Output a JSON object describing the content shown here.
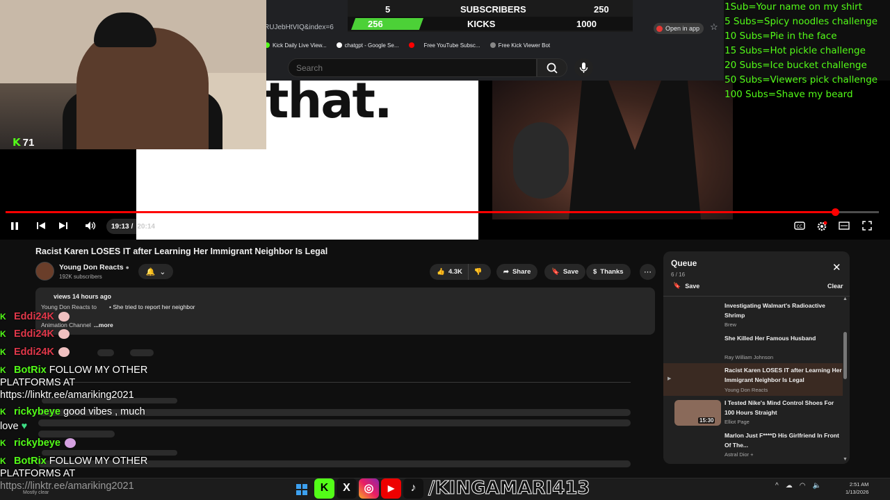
{
  "browser": {
    "url": "RUJebHtVIQ&index=6",
    "open_in_app": "Open in app",
    "bookmarks": [
      {
        "label": "Kick Daily Live View...",
        "icon": "kick-icon"
      },
      {
        "label": "chatgpt - Google Se...",
        "icon": "google-icon"
      },
      {
        "label": "",
        "icon": "youtube-icon"
      },
      {
        "label": "Free YouTube Subsc...",
        "icon": "globe-icon"
      },
      {
        "label": "Free Kick Viewer Bot",
        "icon": "globe-icon"
      }
    ]
  },
  "goal_overlay": {
    "subs_current": "5",
    "subs_label": "SUBSCRIBERS",
    "subs_goal": "250",
    "kicks_current": "256",
    "kicks_label": "KICKS",
    "kicks_goal": "1000",
    "accent": "#4cd137"
  },
  "search": {
    "placeholder": "Search"
  },
  "webcam": {
    "viewer_count": "71"
  },
  "video": {
    "overlay_text": "that.",
    "time_current": "19:13",
    "time_sep": "/",
    "time_total": "20:14",
    "progress_fraction": 0.95
  },
  "stream_goals": [
    "1Sub=Your name on my shirt",
    "5 Subs=Spicy noodles challenge",
    "10 Subs=Pie in the face",
    "15 Subs=Hot pickle challenge",
    "20 Subs=Ice bucket challenge",
    "50 Subs=Viewers pick challenge",
    "100 Subs=Shave my beard"
  ],
  "watch": {
    "title": "Racist Karen LOSES IT after Learning Her Immigrant Neighbor Is Legal",
    "channel_name": "Young Don Reacts",
    "channel_subs": "192K subscribers",
    "likes": "4.3K",
    "share": "Share",
    "save": "Save",
    "thanks": "Thanks",
    "more": "⋯",
    "desc_views": "views",
    "desc_age": "14 hours ago",
    "desc_line1_a": "Young Don Reacts to",
    "desc_line1_b": "• She tried to report her neighbor",
    "desc_line2": "Animation Channel",
    "desc_more": "...more"
  },
  "chat": [
    {
      "user": "Eddi24K",
      "color": "red",
      "text": ""
    },
    {
      "user": "Eddi24K",
      "color": "red",
      "text": ""
    },
    {
      "user": "Eddi24K",
      "color": "red",
      "text": ""
    },
    {
      "user": "BotRix",
      "color": "green",
      "text": "FOLLOW MY OTHER"
    },
    {
      "user": "",
      "color": "",
      "text": "PLATFORMS AT"
    },
    {
      "user": "",
      "color": "",
      "text": "https://linktr.ee/amariking2021"
    },
    {
      "user": "rickybeye",
      "color": "green",
      "text": "good vibes , much"
    },
    {
      "user": "",
      "color": "",
      "text": "love"
    },
    {
      "user": "rickybeye",
      "color": "green",
      "text": ""
    },
    {
      "user": "BotRix",
      "color": "green",
      "text": "FOLLOW MY OTHER"
    },
    {
      "user": "",
      "color": "",
      "text": "PLATFORMS AT"
    }
  ],
  "queue": {
    "title": "Queue",
    "count": "6 / 16",
    "save": "Save",
    "clear": "Clear",
    "items": [
      {
        "title": "Investigating Walmart's Radioactive Shrimp",
        "channel": "Brew",
        "duration": ""
      },
      {
        "title": "She Killed Her Famous Husband",
        "channel": "Ray William Johnson",
        "duration": ""
      },
      {
        "title": "Racist Karen LOSES IT after Learning Her Immigrant Neighbor Is Legal",
        "channel": "Young Don Reacts",
        "duration": "",
        "play_marker": "▶"
      },
      {
        "title": "I Tested Nike's Mind Control Shoes For 100 Hours Straight",
        "channel": "Elliot Page",
        "duration": "15:30"
      },
      {
        "title": "Marlon Just F****D His Girlfriend In Front Of The...",
        "channel": "Astral Dior +",
        "duration": ""
      }
    ]
  },
  "taskbar": {
    "bottom_url": "https://linktr.ee/amariking2021",
    "weather": "Mostly clear",
    "handle": "/KINGAMARI413",
    "time": "2:51 AM",
    "date": "1/13/2026"
  }
}
